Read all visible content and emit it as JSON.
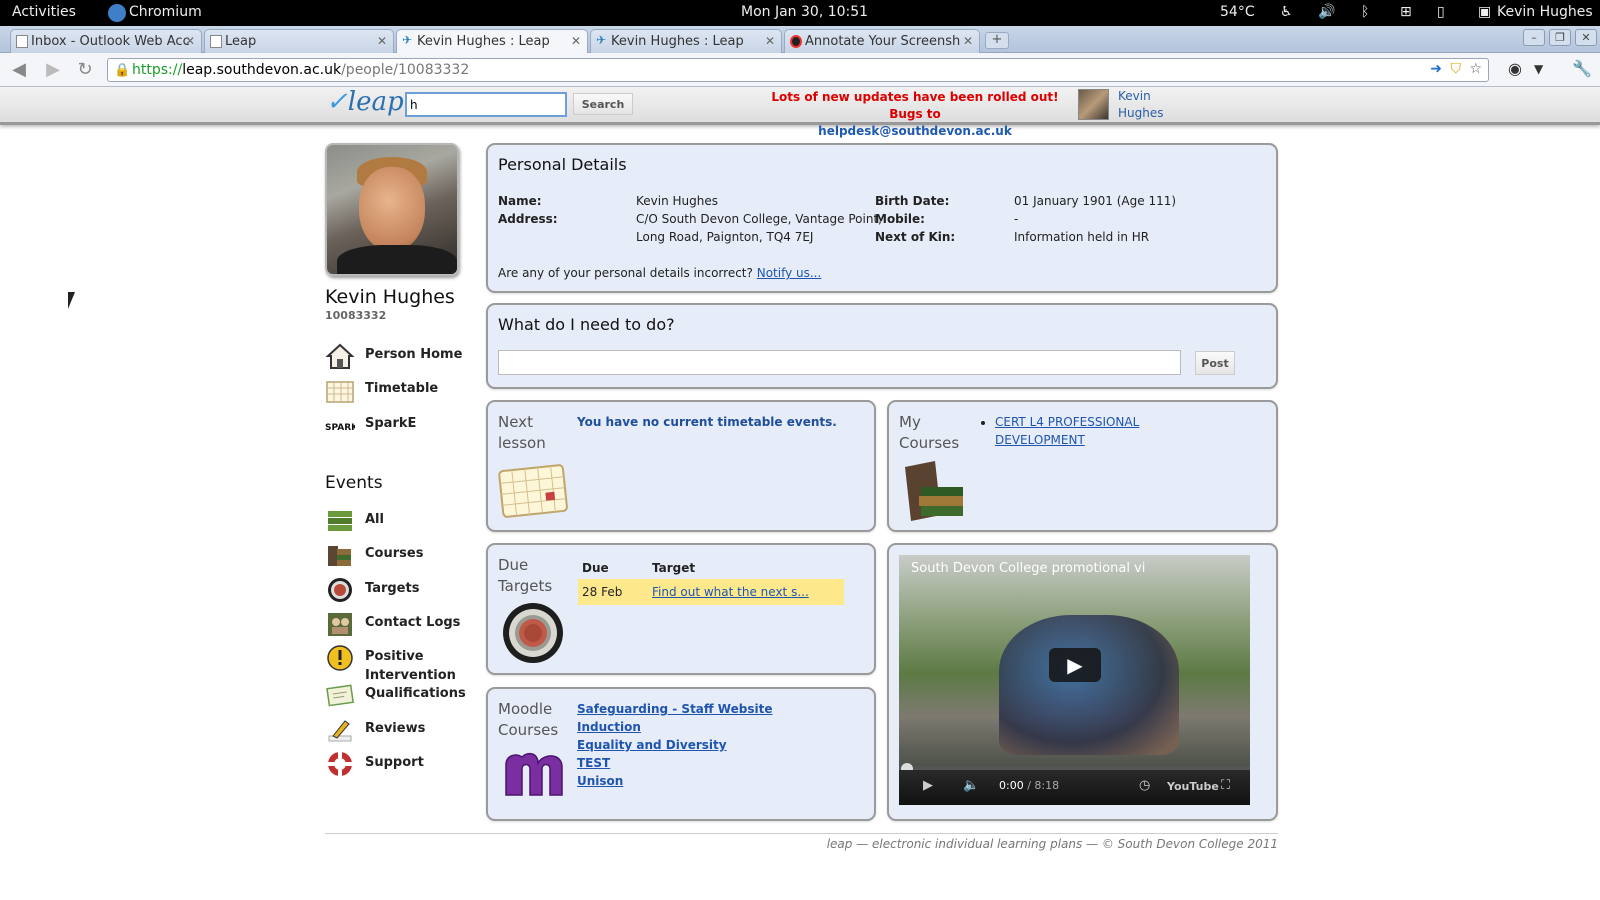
{
  "system": {
    "activities": "Activities",
    "app_name": "Chromium",
    "clock": "Mon Jan 30, 10:51",
    "temperature": "54°C",
    "user": "Kevin Hughes"
  },
  "browser": {
    "tabs": [
      {
        "title": "Inbox - Outlook Web Acc",
        "active": false
      },
      {
        "title": "Leap",
        "active": false
      },
      {
        "title": "Kevin Hughes : Leap",
        "active": true
      },
      {
        "title": "Kevin Hughes : Leap",
        "active": false
      },
      {
        "title": "Annotate Your Screensho",
        "active": false
      }
    ],
    "url_scheme": "https://",
    "url_host": "leap.southdevon.ac.uk",
    "url_path": "/people/10083332"
  },
  "leap_header": {
    "logo": "leap",
    "search_value": "h",
    "search_button": "Search",
    "notice_line1": "Lots of new updates have been rolled out! Bugs to",
    "notice_email": "helpdesk@southdevon.ac.uk",
    "user_first": "Kevin",
    "user_last": "Hughes"
  },
  "profile": {
    "name": "Kevin Hughes",
    "id": "10083332"
  },
  "nav": [
    {
      "label": "Person Home",
      "icon": "house-icon"
    },
    {
      "label": "Timetable",
      "icon": "calendar-icon"
    },
    {
      "label": "SparkE",
      "icon": "sparke-logo-icon"
    }
  ],
  "events": {
    "heading": "Events",
    "items": [
      {
        "label": "All",
        "icon": "stack-icon"
      },
      {
        "label": "Courses",
        "icon": "books-icon"
      },
      {
        "label": "Targets",
        "icon": "target-icon"
      },
      {
        "label": "Contact Logs",
        "icon": "contact-log-icon"
      },
      {
        "label": "Positive Intervention",
        "icon": "exclamation-icon"
      },
      {
        "label": "Qualifications",
        "icon": "certificate-icon"
      },
      {
        "label": "Reviews",
        "icon": "pencil-icon"
      },
      {
        "label": "Support",
        "icon": "lifebuoy-icon"
      }
    ]
  },
  "personal_details": {
    "title": "Personal Details",
    "name_label": "Name:",
    "name": "Kevin Hughes",
    "address_label": "Address:",
    "address_line1": "C/O South Devon College, Vantage Point,",
    "address_line2": "Long Road, Paignton, TQ4 7EJ",
    "birth_label": "Birth Date:",
    "birth": "01 January 1901 (Age 111)",
    "mobile_label": "Mobile:",
    "mobile": "-",
    "kin_label": "Next of Kin:",
    "kin": "Information held in HR",
    "incorrect_text": "Are any of your personal details incorrect?",
    "notify_link": "Notify us..."
  },
  "todo": {
    "title": "What do I need to do?",
    "input_value": "",
    "post_button": "Post"
  },
  "next_lesson": {
    "title_line1": "Next",
    "title_line2": "lesson",
    "message": "You have no current timetable events."
  },
  "my_courses": {
    "title_line1": "My",
    "title_line2": "Courses",
    "course_line1": "CERT L4 PROFESSIONAL",
    "course_line2": "DEVELOPMENT"
  },
  "due_targets": {
    "title_line1": "Due",
    "title_line2": "Targets",
    "col_due": "Due",
    "col_target": "Target",
    "rows": [
      {
        "due": "28 Feb",
        "target": "Find out what the next s..."
      }
    ]
  },
  "moodle": {
    "title_line1": "Moodle",
    "title_line2": "Courses",
    "links": [
      "Safeguarding - Staff Website",
      "Induction",
      "Equality and Diversity",
      "TEST",
      "Unison"
    ]
  },
  "video": {
    "title": "South Devon College promotional vi",
    "time_current": "0:00",
    "time_total": "/ 8:18",
    "brand": "YouTube"
  },
  "footer": "leap — electronic individual learning plans — © South Devon College 2011"
}
